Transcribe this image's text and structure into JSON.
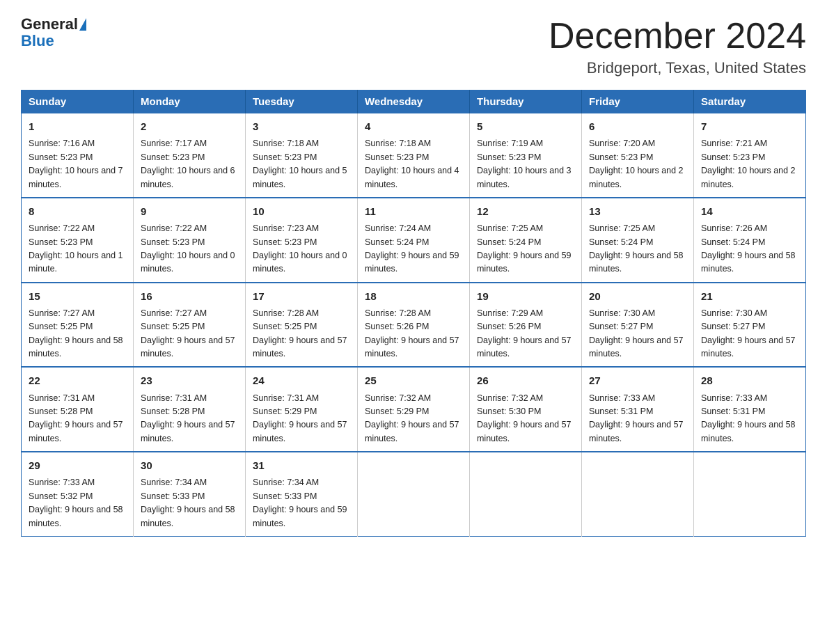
{
  "header": {
    "logo_general": "General",
    "logo_blue": "Blue",
    "month_title": "December 2024",
    "location": "Bridgeport, Texas, United States"
  },
  "weekdays": [
    "Sunday",
    "Monday",
    "Tuesday",
    "Wednesday",
    "Thursday",
    "Friday",
    "Saturday"
  ],
  "rows": [
    [
      {
        "day": "1",
        "sunrise": "7:16 AM",
        "sunset": "5:23 PM",
        "daylight": "10 hours and 7 minutes."
      },
      {
        "day": "2",
        "sunrise": "7:17 AM",
        "sunset": "5:23 PM",
        "daylight": "10 hours and 6 minutes."
      },
      {
        "day": "3",
        "sunrise": "7:18 AM",
        "sunset": "5:23 PM",
        "daylight": "10 hours and 5 minutes."
      },
      {
        "day": "4",
        "sunrise": "7:18 AM",
        "sunset": "5:23 PM",
        "daylight": "10 hours and 4 minutes."
      },
      {
        "day": "5",
        "sunrise": "7:19 AM",
        "sunset": "5:23 PM",
        "daylight": "10 hours and 3 minutes."
      },
      {
        "day": "6",
        "sunrise": "7:20 AM",
        "sunset": "5:23 PM",
        "daylight": "10 hours and 2 minutes."
      },
      {
        "day": "7",
        "sunrise": "7:21 AM",
        "sunset": "5:23 PM",
        "daylight": "10 hours and 2 minutes."
      }
    ],
    [
      {
        "day": "8",
        "sunrise": "7:22 AM",
        "sunset": "5:23 PM",
        "daylight": "10 hours and 1 minute."
      },
      {
        "day": "9",
        "sunrise": "7:22 AM",
        "sunset": "5:23 PM",
        "daylight": "10 hours and 0 minutes."
      },
      {
        "day": "10",
        "sunrise": "7:23 AM",
        "sunset": "5:23 PM",
        "daylight": "10 hours and 0 minutes."
      },
      {
        "day": "11",
        "sunrise": "7:24 AM",
        "sunset": "5:24 PM",
        "daylight": "9 hours and 59 minutes."
      },
      {
        "day": "12",
        "sunrise": "7:25 AM",
        "sunset": "5:24 PM",
        "daylight": "9 hours and 59 minutes."
      },
      {
        "day": "13",
        "sunrise": "7:25 AM",
        "sunset": "5:24 PM",
        "daylight": "9 hours and 58 minutes."
      },
      {
        "day": "14",
        "sunrise": "7:26 AM",
        "sunset": "5:24 PM",
        "daylight": "9 hours and 58 minutes."
      }
    ],
    [
      {
        "day": "15",
        "sunrise": "7:27 AM",
        "sunset": "5:25 PM",
        "daylight": "9 hours and 58 minutes."
      },
      {
        "day": "16",
        "sunrise": "7:27 AM",
        "sunset": "5:25 PM",
        "daylight": "9 hours and 57 minutes."
      },
      {
        "day": "17",
        "sunrise": "7:28 AM",
        "sunset": "5:25 PM",
        "daylight": "9 hours and 57 minutes."
      },
      {
        "day": "18",
        "sunrise": "7:28 AM",
        "sunset": "5:26 PM",
        "daylight": "9 hours and 57 minutes."
      },
      {
        "day": "19",
        "sunrise": "7:29 AM",
        "sunset": "5:26 PM",
        "daylight": "9 hours and 57 minutes."
      },
      {
        "day": "20",
        "sunrise": "7:30 AM",
        "sunset": "5:27 PM",
        "daylight": "9 hours and 57 minutes."
      },
      {
        "day": "21",
        "sunrise": "7:30 AM",
        "sunset": "5:27 PM",
        "daylight": "9 hours and 57 minutes."
      }
    ],
    [
      {
        "day": "22",
        "sunrise": "7:31 AM",
        "sunset": "5:28 PM",
        "daylight": "9 hours and 57 minutes."
      },
      {
        "day": "23",
        "sunrise": "7:31 AM",
        "sunset": "5:28 PM",
        "daylight": "9 hours and 57 minutes."
      },
      {
        "day": "24",
        "sunrise": "7:31 AM",
        "sunset": "5:29 PM",
        "daylight": "9 hours and 57 minutes."
      },
      {
        "day": "25",
        "sunrise": "7:32 AM",
        "sunset": "5:29 PM",
        "daylight": "9 hours and 57 minutes."
      },
      {
        "day": "26",
        "sunrise": "7:32 AM",
        "sunset": "5:30 PM",
        "daylight": "9 hours and 57 minutes."
      },
      {
        "day": "27",
        "sunrise": "7:33 AM",
        "sunset": "5:31 PM",
        "daylight": "9 hours and 57 minutes."
      },
      {
        "day": "28",
        "sunrise": "7:33 AM",
        "sunset": "5:31 PM",
        "daylight": "9 hours and 58 minutes."
      }
    ],
    [
      {
        "day": "29",
        "sunrise": "7:33 AM",
        "sunset": "5:32 PM",
        "daylight": "9 hours and 58 minutes."
      },
      {
        "day": "30",
        "sunrise": "7:34 AM",
        "sunset": "5:33 PM",
        "daylight": "9 hours and 58 minutes."
      },
      {
        "day": "31",
        "sunrise": "7:34 AM",
        "sunset": "5:33 PM",
        "daylight": "9 hours and 59 minutes."
      },
      null,
      null,
      null,
      null
    ]
  ]
}
